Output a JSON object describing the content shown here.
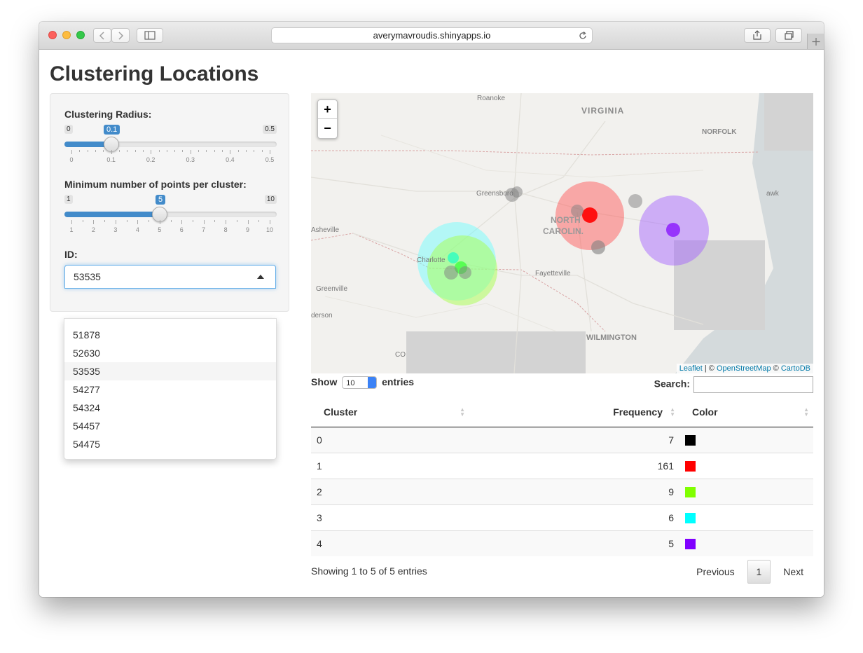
{
  "browser": {
    "url": "averymavroudis.shinyapps.io"
  },
  "page": {
    "title": "Clustering Locations"
  },
  "sidebar": {
    "radius": {
      "label": "Clustering Radius:",
      "min": "0",
      "max": "0.5",
      "value": "0.1",
      "value_num": 0.1,
      "ticks": [
        "0",
        "0.1",
        "0.2",
        "0.3",
        "0.4",
        "0.5"
      ]
    },
    "minpts": {
      "label": "Minimum number of points per cluster:",
      "min": "1",
      "max": "10",
      "value": "5",
      "value_num": 5,
      "ticks": [
        "1",
        "2",
        "3",
        "4",
        "5",
        "6",
        "7",
        "8",
        "9",
        "10"
      ]
    },
    "id": {
      "label": "ID:",
      "selected": "53535",
      "options": [
        "51878",
        "52630",
        "53535",
        "54277",
        "54324",
        "54457",
        "54475"
      ]
    }
  },
  "map": {
    "zoom_in": "+",
    "zoom_out": "−",
    "places": [
      "Roanoke",
      "VIRGINIA",
      "NORFOLK",
      "Greensboro",
      "NORTH",
      "CAROLIN.",
      "Asheville",
      "Charlotte",
      "Fayetteville",
      "Greenville",
      "derson",
      "WILMINGTON",
      "awk",
      "CO"
    ],
    "attribution": {
      "leaflet": "Leaflet",
      "sep1": " | © ",
      "osm": "OpenStreetMap",
      "sep2": " © ",
      "carto": "CartoDB"
    }
  },
  "table": {
    "show_label": "Show",
    "page_length": "10",
    "entries_label": "entries",
    "search_label": "Search:",
    "columns": [
      "Cluster",
      "Frequency",
      "Color"
    ],
    "rows": [
      {
        "cluster": "0",
        "frequency": "7",
        "color": "#000000"
      },
      {
        "cluster": "1",
        "frequency": "161",
        "color": "#ff0000"
      },
      {
        "cluster": "2",
        "frequency": "9",
        "color": "#80ff00"
      },
      {
        "cluster": "3",
        "frequency": "6",
        "color": "#00ffff"
      },
      {
        "cluster": "4",
        "frequency": "5",
        "color": "#8000ff"
      }
    ],
    "info": "Showing 1 to 5 of 5 entries",
    "prev": "Previous",
    "page": "1",
    "next": "Next"
  }
}
